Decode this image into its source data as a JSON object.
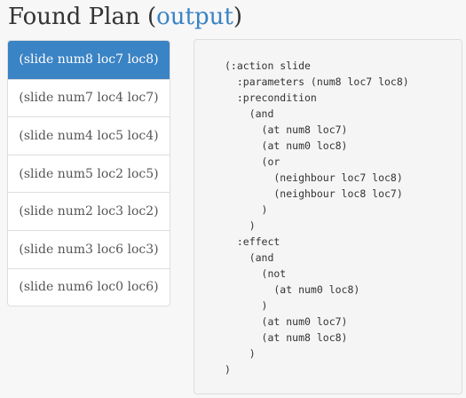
{
  "header": {
    "title": "Found Plan",
    "paren_open": "(",
    "link_label": "output",
    "paren_close": ")"
  },
  "actions": [
    {
      "label": "(slide num8 loc7 loc8)",
      "active": true
    },
    {
      "label": "(slide num7 loc4 loc7)",
      "active": false
    },
    {
      "label": "(slide num4 loc5 loc4)",
      "active": false
    },
    {
      "label": "(slide num5 loc2 loc5)",
      "active": false
    },
    {
      "label": "(slide num2 loc3 loc2)",
      "active": false
    },
    {
      "label": "(slide num3 loc6 loc3)",
      "active": false
    },
    {
      "label": "(slide num6 loc0 loc6)",
      "active": false
    }
  ],
  "code": {
    "text": "(:action slide\n  :parameters (num8 loc7 loc8)\n  :precondition\n    (and\n      (at num8 loc7)\n      (at num0 loc8)\n      (or\n        (neighbour loc7 loc8)\n        (neighbour loc8 loc7)\n      )\n    )\n  :effect\n    (and\n      (not\n        (at num0 loc8)\n      )\n      (at num0 loc7)\n      (at num8 loc8)\n    )\n)"
  },
  "colors": {
    "accent": "#3a83c4",
    "text": "#333333",
    "panel_background": "#f5f5f5",
    "border": "#dddddd"
  }
}
